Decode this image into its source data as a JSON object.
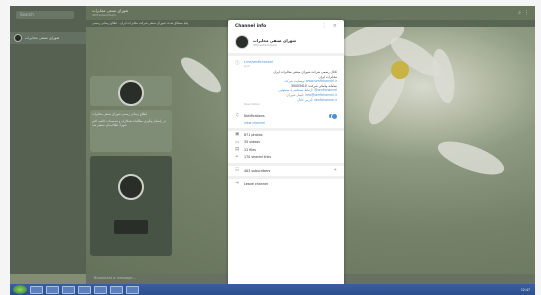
{
  "sidebar": {
    "search_placeholder": "Search",
    "chats": [
      {
        "name": "شورای صنفی مخابرات"
      }
    ]
  },
  "chat": {
    "header_title": "شورای صنفی مخابرات",
    "header_subtitle": "403 subscribers",
    "pinned_text": "پیام سنجاق شده: شورای صنفی شرکت مخابرات ایران - اطلاع رسانی رسمی",
    "messages": [
      {
        "text": "اطلاع رسانی رسمی شورای صنفی مخابرات"
      },
      {
        "text": "در راستای پیگیری مطالبات همکاران و تصمیمات جلسه اخیر شورا، اطلاعیه‌ای منتشر شد"
      }
    ],
    "composer_placeholder": "Broadcast a message..."
  },
  "dialog": {
    "title": "Channel info",
    "channel_name": "شورای صنفی مخابرات",
    "subscribers_short": "403 subscribers",
    "link": "t.me/senfichannel",
    "link_label": "Link",
    "description_lines": [
      "کانال رسمی شرکت شورای صنفی مخابرات ایران",
      "مخابرات ایران",
      "وبسایت شرکت: www.senfichannel.ir",
      "سامانه پیامکی شرکت: 30003410",
      "ارتباط مستقیم با مسئولین: @senfichannel",
      "ایمیل شورای: info@senfichannel.ir",
      "آدرس کانال: senfichannel.ir",
      "Description"
    ],
    "notifications_label": "Notifications",
    "view_link": "view channel",
    "media": [
      {
        "icon": "photo-icon",
        "label": "871 photos"
      },
      {
        "icon": "video-icon",
        "label": "35 videos"
      },
      {
        "icon": "file-icon",
        "label": "12 files"
      },
      {
        "icon": "link-icon",
        "label": "170 shared links"
      }
    ],
    "subscribers_label": "403 subscribers",
    "leave_label": "Leave channel"
  },
  "taskbar": {
    "clock": "12:47"
  }
}
